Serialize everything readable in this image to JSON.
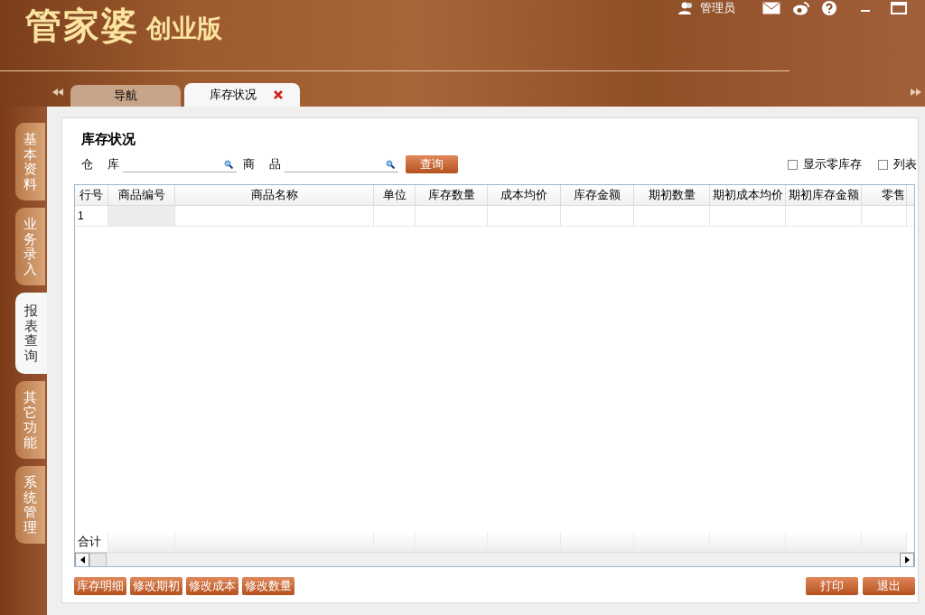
{
  "header": {
    "logo": "管家婆",
    "edition": "创业版",
    "user": "管理员"
  },
  "tabs": [
    {
      "label": "导航",
      "selected": false,
      "closable": false
    },
    {
      "label": "库存状况",
      "selected": true,
      "closable": true
    }
  ],
  "side_tabs": [
    {
      "label": "基本资料",
      "selected": false
    },
    {
      "label": "业务录入",
      "selected": false
    },
    {
      "label": "报表查询",
      "selected": true
    },
    {
      "label": "其它功能",
      "selected": false
    },
    {
      "label": "系统管理",
      "selected": false
    }
  ],
  "page_title": "库存状况",
  "filters": [
    {
      "label_1": "仓",
      "label_2": "库"
    },
    {
      "label_1": "商",
      "label_2": "品"
    }
  ],
  "query_button": "查询",
  "options": [
    {
      "label": "显示零库存",
      "checked": false
    },
    {
      "label": "列表",
      "checked": false
    }
  ],
  "table": {
    "columns": [
      "行号",
      "商品编号",
      "商品名称",
      "单位",
      "库存数量",
      "成本均价",
      "库存金额",
      "期初数量",
      "期初成本均价",
      "期初库存金额",
      "零售"
    ],
    "rows": [
      [
        "1"
      ]
    ],
    "footer": "合计"
  },
  "left_buttons": [
    "库存明细",
    "修改期初",
    "修改成本",
    "修改数量"
  ],
  "right_buttons": [
    "打印",
    "退出"
  ]
}
